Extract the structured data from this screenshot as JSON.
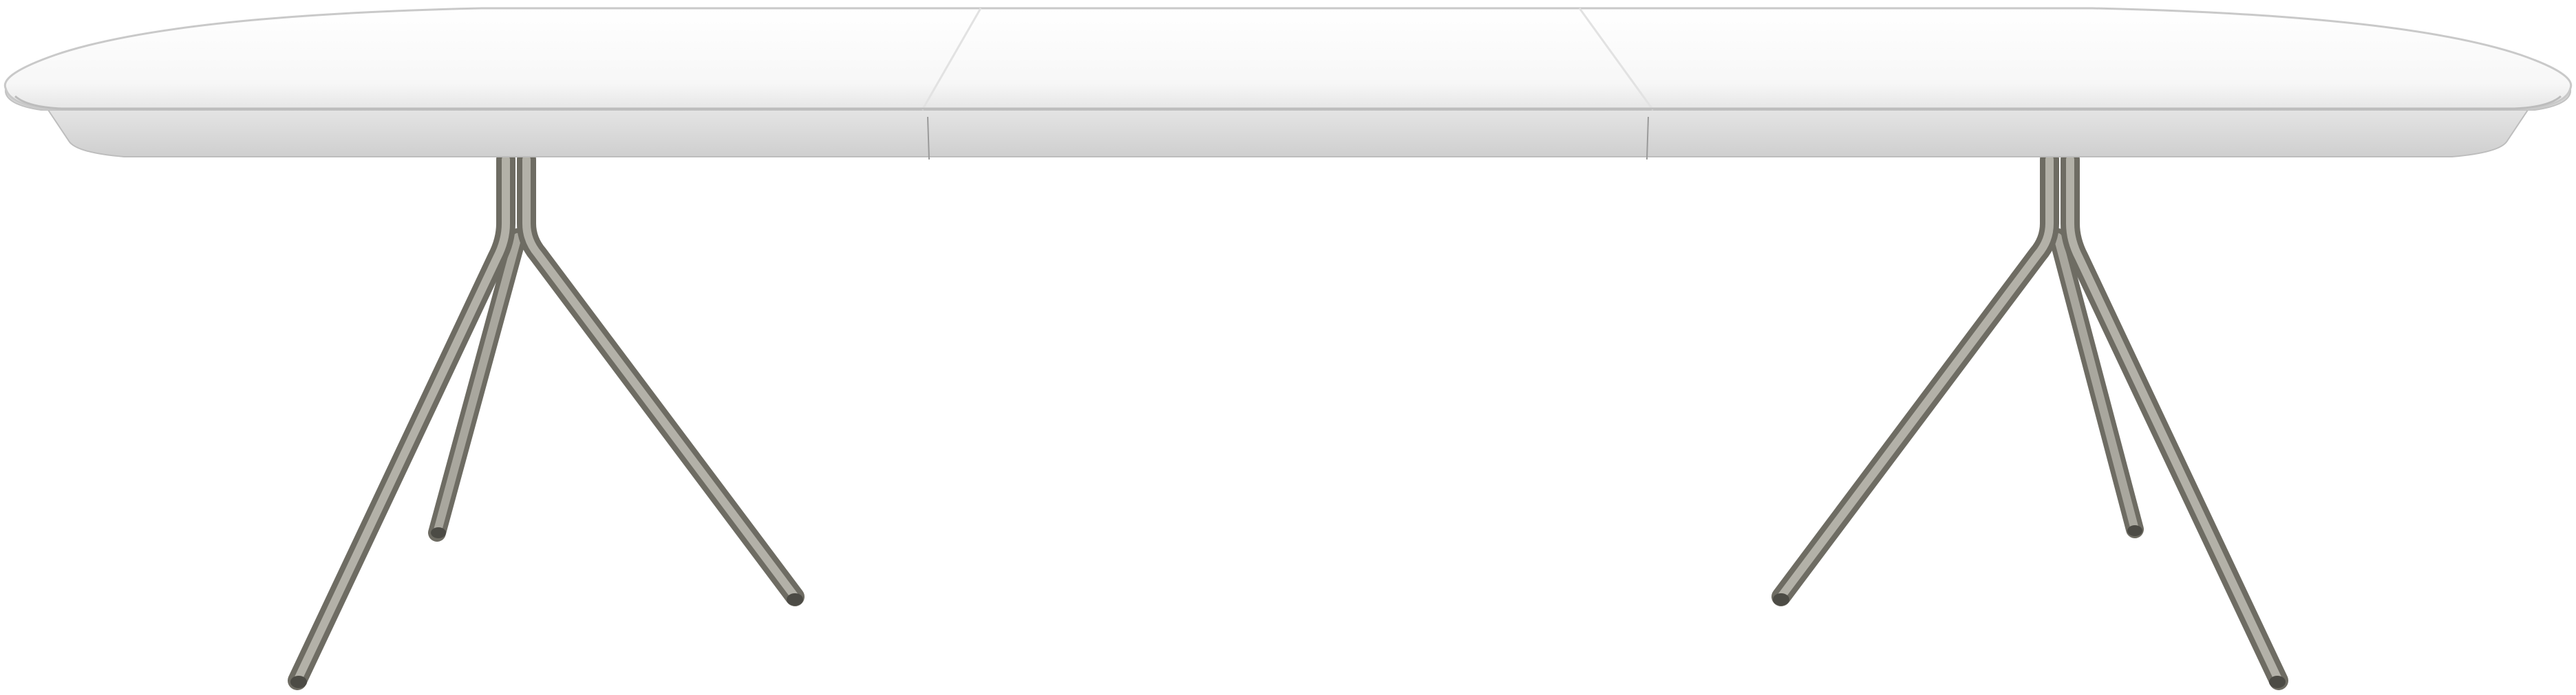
{
  "image": {
    "subject": "extendable-dining-table",
    "background_color": "#ffffff",
    "colors": {
      "tabletop_top": "#fbfbfb",
      "tabletop_mid": "#f3f3f3",
      "tabletop_edge": "#d9d9d9",
      "apron": "#d2d2d2",
      "apron_shadow": "#bdbdbd",
      "leg": "#8c8a80",
      "leg_highlight": "#b5b3aa",
      "leg_shadow": "#6e6c63"
    },
    "tabletop": {
      "sections": [
        "left-end-section",
        "center-extension-leaf",
        "right-end-section"
      ]
    },
    "leg_bases": [
      "left-leg-base",
      "right-leg-base"
    ],
    "legs_per_base": 3
  }
}
